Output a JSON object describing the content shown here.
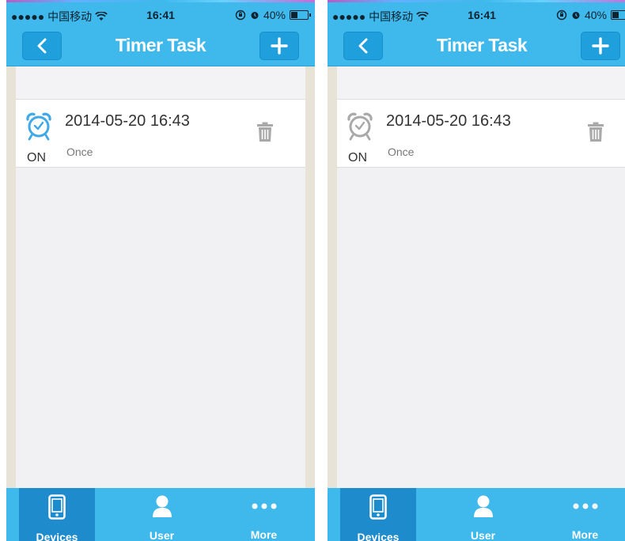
{
  "colors": {
    "accent": "#3fb8ec",
    "active_tab": "#1d8bcc",
    "alarm_on": "#3fa9e8",
    "alarm_off": "#a9a9a9"
  },
  "screens": [
    {
      "status_bar": {
        "carrier": "●●●●● 中国移动",
        "time": "16:41",
        "battery": "40%",
        "battery_level": 0.4
      },
      "nav": {
        "title": "Timer Task",
        "back_icon": "chevron-left-icon",
        "add_icon": "plus-icon"
      },
      "task": {
        "datetime": "2014-05-20 16:43",
        "repeat": "Once",
        "state": "ON",
        "alarm_icon": "alarm-clock-icon",
        "alarm_active": true
      },
      "tabs": [
        {
          "label": "Devices",
          "icon": "phone-icon"
        },
        {
          "label": "User",
          "icon": "user-icon"
        },
        {
          "label": "More",
          "icon": "more-icon"
        }
      ]
    },
    {
      "status_bar": {
        "carrier": "●●●●● 中国移动",
        "time": "16:41",
        "battery": "40%",
        "battery_level": 0.4
      },
      "nav": {
        "title": "Timer Task",
        "back_icon": "chevron-left-icon",
        "add_icon": "plus-icon"
      },
      "task": {
        "datetime": "2014-05-20 16:43",
        "repeat": "Once",
        "state": "ON",
        "alarm_icon": "alarm-clock-icon",
        "alarm_active": false
      },
      "tabs": [
        {
          "label": "Devices",
          "icon": "phone-icon"
        },
        {
          "label": "User",
          "icon": "user-icon"
        },
        {
          "label": "More",
          "icon": "more-icon"
        }
      ]
    }
  ]
}
